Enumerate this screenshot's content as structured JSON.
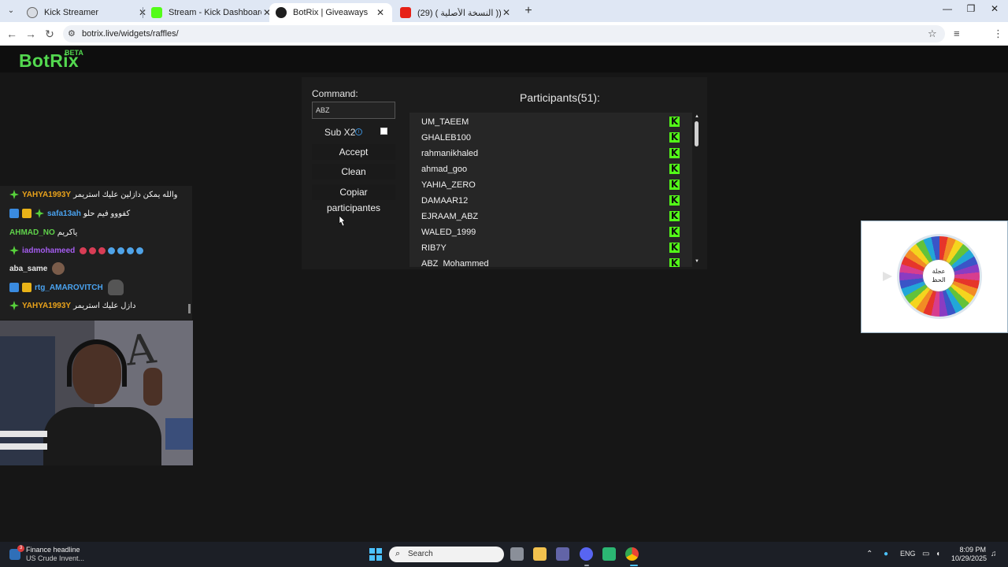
{
  "browser": {
    "tabs": [
      {
        "title": "Kick Streamer",
        "favicon": "kick-streamer-favicon",
        "active": false
      },
      {
        "title": "Stream - Kick Dashboard",
        "favicon": "kick-favicon",
        "active": false
      },
      {
        "title": "BotRix | Giveaways",
        "favicon": "botrix-favicon",
        "active": true
      },
      {
        "title": "(29) كنت ميتا (( النسخة الأصلية )",
        "favicon": "youtube-favicon",
        "active": false
      }
    ],
    "url": "botrix.live/widgets/raffles/"
  },
  "site": {
    "logo": "BotRix",
    "beta": "BETA",
    "brand_color": "#53d84f"
  },
  "raffle": {
    "command_label": "Command:",
    "command_value": "ABZ",
    "sub_label": "Sub X2",
    "sub_checked": false,
    "accept_label": "Accept",
    "clean_label": "Clean",
    "copy_label": "Copiar participantes",
    "participants_title": "Participants(51):",
    "participants": [
      "UM_TAEEM",
      "GHALEB100",
      "rahmanikhaled",
      "ahmad_goo",
      "YAHIA_ZERO",
      "DAMAAR12",
      "EJRAAM_ABZ",
      "WALED_1999",
      "RIB7Y",
      "ABZ_Mohammed"
    ],
    "kick_badge": "K",
    "kick_color": "#53fc18"
  },
  "chat": [
    {
      "user": "YAHYA1993Y",
      "color": "#e9a21b",
      "badges": [
        "diamond"
      ],
      "message": "والله يمكن دازلين عليك استريمر"
    },
    {
      "user": "safa13ah",
      "color": "#4aa3f0",
      "badges": [
        "blue",
        "gold",
        "diamond"
      ],
      "message": "كفووو فيم حلو"
    },
    {
      "user": "AHMAD_NO",
      "color": "#5fd14a",
      "badges": [],
      "message": "ياكريم"
    },
    {
      "user": "iadmohameed",
      "color": "#a55df0",
      "badges": [
        "diamond"
      ],
      "message": "",
      "emotes": [
        "heart",
        "heart",
        "heart",
        "bheart",
        "bheart",
        "bheart",
        "bheart"
      ]
    },
    {
      "user": "aba_same",
      "color": "#e6e6e6",
      "badges": [],
      "message": "",
      "emotes": [
        "face"
      ]
    },
    {
      "user": "rtg_AMAROVITCH",
      "color": "#4aa3f0",
      "badges": [
        "blue",
        "gold"
      ],
      "message": "",
      "emotes": [
        "ghost"
      ]
    },
    {
      "user": "YAHYA1993Y",
      "color": "#e9a21b",
      "badges": [
        "diamond"
      ],
      "message": "دازل عليك استريمر"
    }
  ],
  "wheel": {
    "hub_line1": "عجلة",
    "hub_line2": "الحظ"
  },
  "taskbar": {
    "news_title": "Finance headline",
    "news_sub": "US Crude Invent...",
    "news_badge": "3",
    "search_placeholder": "Search",
    "lang": "ENG",
    "time": "8:09 PM",
    "date": "10/29/2025"
  }
}
